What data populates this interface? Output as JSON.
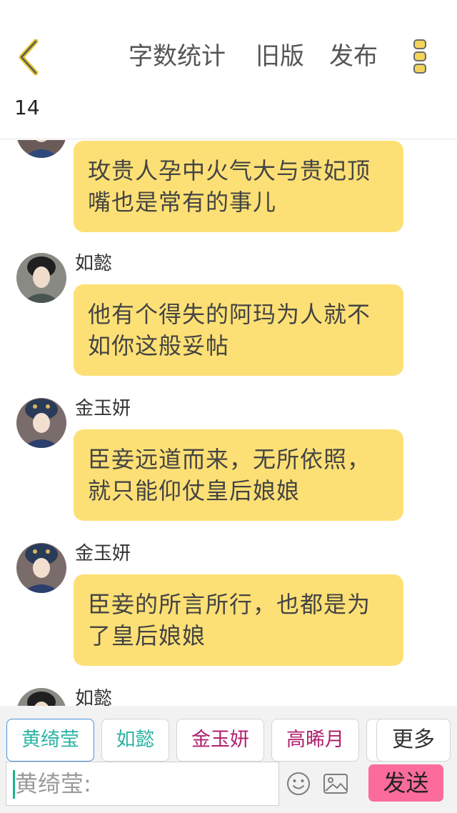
{
  "header": {
    "word_count_label": "字数统计",
    "old_version_label": "旧版",
    "publish_label": "发布",
    "count": "14",
    "accent_color": "#e3c52f"
  },
  "messages": [
    {
      "name": "",
      "text": "玫贵人孕中火气大与贵妃顶嘴也是常有的事儿"
    },
    {
      "name": "如懿",
      "text": "他有个得失的阿玛为人就不如你这般妥帖"
    },
    {
      "name": "金玉妍",
      "text": "臣妾远道而来，无所依照，就只能仰仗皇后娘娘"
    },
    {
      "name": "金玉妍",
      "text": "臣妾的所言所行，也都是为了皇后娘娘"
    },
    {
      "name": "如懿",
      "text": ""
    }
  ],
  "characters": [
    {
      "label": "黄绮莹",
      "color": "#2bb3a3"
    },
    {
      "label": "如懿",
      "color": "#2bb3a3"
    },
    {
      "label": "金玉妍",
      "color": "#b0206e"
    },
    {
      "label": "高晞月",
      "color": "#b0206e"
    }
  ],
  "more_label": "更多",
  "input": {
    "placeholder": "黄绮莹:"
  },
  "send_label": "发送",
  "icons": {
    "emoji": "smiley-icon",
    "image": "image-icon",
    "back": "chevron-left-icon",
    "more": "vertical-dots-icon"
  }
}
